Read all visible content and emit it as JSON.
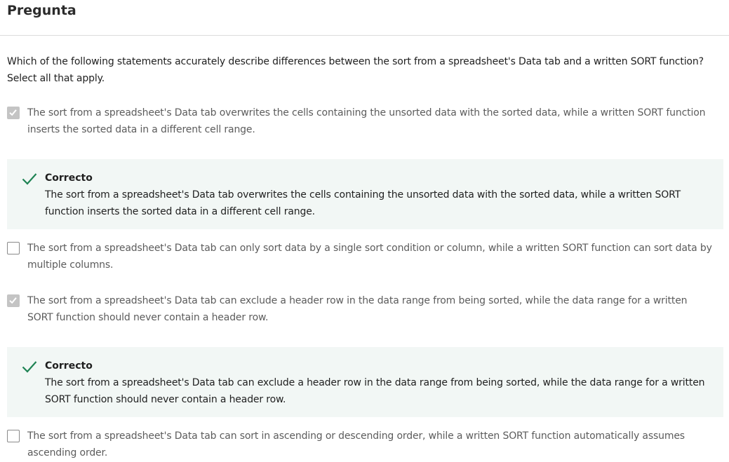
{
  "header": {
    "title": "Pregunta"
  },
  "question": {
    "text": "Which of the following statements accurately describe differences between the sort from a spreadsheet's Data tab and a written SORT function? Select all that apply."
  },
  "options": [
    {
      "text": "The sort from a spreadsheet's Data tab overwrites the cells containing the unsorted data with the sorted data, while a written SORT function inserts the sorted data in a different cell range.",
      "checked": true,
      "feedback": {
        "title": "Correcto",
        "text": "The sort from a spreadsheet's Data tab overwrites the cells containing the unsorted data with the sorted data, while a written SORT function inserts the sorted data in a different cell range."
      }
    },
    {
      "text": "The sort from a spreadsheet's Data tab can only sort data by a single sort condition or column, while a written SORT function can sort data by multiple columns.",
      "checked": false
    },
    {
      "text": "The sort from a spreadsheet's Data tab can exclude a header row in the data range from being sorted, while the data range for a written SORT function should never contain a header row.",
      "checked": true,
      "feedback": {
        "title": "Correcto",
        "text": "The sort from a spreadsheet's Data tab can exclude a header row in the data range from being sorted, while the data range for a written SORT function should never contain a header row."
      }
    },
    {
      "text": "The sort from a spreadsheet's Data tab can sort in ascending or descending order, while a written SORT function automatically assumes ascending order.",
      "checked": false
    }
  ],
  "icons": {
    "checkbox_checked": "checkmark-icon",
    "feedback_correct": "checkmark-icon"
  },
  "colors": {
    "correct_green": "#1f8354",
    "feedback_background": "#f2f7f5",
    "checked_checkbox": "#c4c4c4"
  }
}
